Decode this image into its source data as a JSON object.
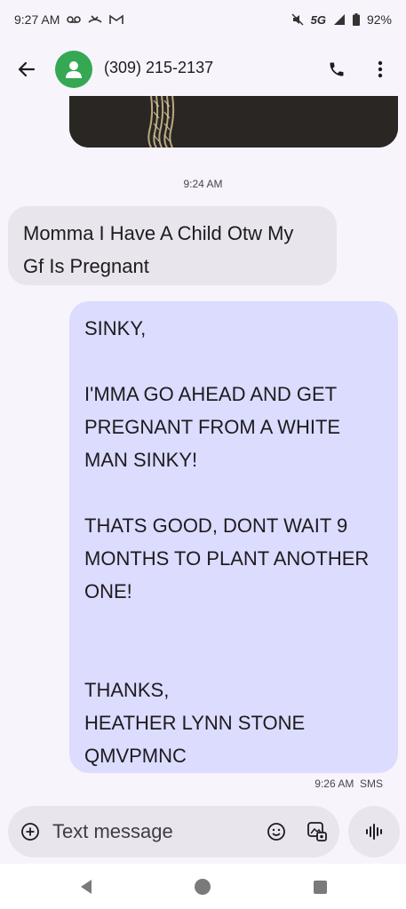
{
  "status_bar": {
    "time": "9:27 AM",
    "network": "5G",
    "battery": "92%"
  },
  "app_bar": {
    "contact": "(309) 215-2137"
  },
  "thread": {
    "timestamp_1": "9:24 AM",
    "incoming_lines": [
      "Momma I Have A Child Otw My",
      "Gf Is Pregnant"
    ],
    "outgoing_lines": [
      "SINKY,",
      "",
      "I'MMA GO AHEAD AND GET",
      "PREGNANT FROM A WHITE",
      "MAN SINKY!",
      "",
      "THATS GOOD, DONT WAIT 9",
      "MONTHS TO PLANT ANOTHER",
      "ONE!",
      "",
      "",
      "THANKS,",
      "HEATHER LYNN STONE",
      "QMVPMNC"
    ],
    "outgoing_meta": "9:26 AM  SMS"
  },
  "composer": {
    "placeholder": "Text message"
  },
  "colors": {
    "incoming_bubble": "#e8e6ec",
    "outgoing_bubble": "#dcdcff",
    "avatar": "#34a853",
    "background": "#f7f4fb"
  },
  "icons": [
    "voicemail-icon",
    "missed-call-icon",
    "gmail-icon",
    "mute-icon",
    "signal-icon",
    "battery-icon",
    "back-arrow-icon",
    "person-icon",
    "phone-icon",
    "more-vert-icon",
    "add-icon",
    "emoji-icon",
    "gallery-icon",
    "voice-icon",
    "nav-back-icon",
    "nav-home-icon",
    "nav-recents-icon"
  ]
}
